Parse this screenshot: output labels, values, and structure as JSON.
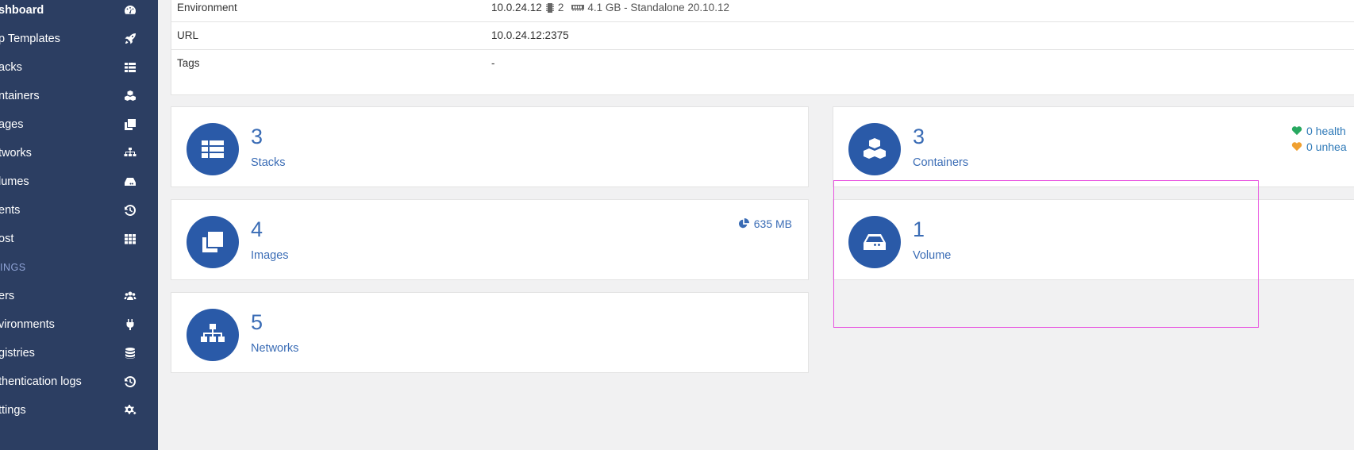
{
  "sidebar": {
    "items": [
      {
        "label": "shboard",
        "icon": "tachometer-icon",
        "bold": true
      },
      {
        "label": "p Templates",
        "icon": "rocket-icon"
      },
      {
        "label": "acks",
        "icon": "th-list-icon"
      },
      {
        "label": "ntainers",
        "icon": "cubes-icon"
      },
      {
        "label": "ages",
        "icon": "clone-icon"
      },
      {
        "label": "tworks",
        "icon": "sitemap-icon"
      },
      {
        "label": "lumes",
        "icon": "hdd-icon"
      },
      {
        "label": "ents",
        "icon": "history-icon"
      },
      {
        "label": "ost",
        "icon": "th-icon"
      }
    ],
    "section_label": "INGS",
    "settings_items": [
      {
        "label": "ers",
        "icon": "users-icon"
      },
      {
        "label": "vironments",
        "icon": "plug-icon"
      },
      {
        "label": "gistries",
        "icon": "database-icon"
      },
      {
        "label": "thentication logs",
        "icon": "history-icon"
      },
      {
        "label": "ttings",
        "icon": "cogs-icon"
      }
    ]
  },
  "info": {
    "environment_label": "Environment",
    "environment_ip": "10.0.24.12",
    "cpu_count": "2",
    "environment_rest": "4.1 GB - Standalone 20.10.12",
    "url_label": "URL",
    "url_value": "10.0.24.12:2375",
    "tags_label": "Tags",
    "tags_value": "-"
  },
  "cards": {
    "stacks": {
      "count": "3",
      "label": "Stacks"
    },
    "containers": {
      "count": "3",
      "label": "Containers",
      "healthy": "0 health",
      "unhealthy": "0 unhea"
    },
    "images": {
      "count": "4",
      "label": "Images",
      "size": "635 MB"
    },
    "volumes": {
      "count": "1",
      "label": "Volume"
    },
    "networks": {
      "count": "5",
      "label": "Networks"
    }
  },
  "colors": {
    "sidebar_bg": "#2c3e62",
    "accent": "#2a5aa8",
    "highlight": "#e855e0"
  }
}
